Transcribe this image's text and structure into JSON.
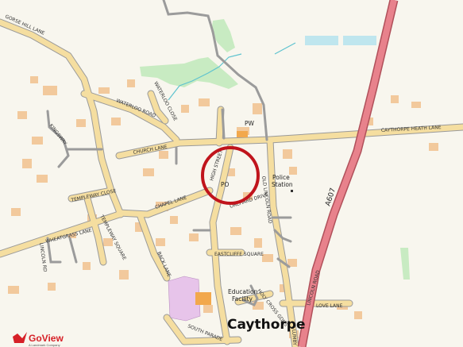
{
  "map": {
    "place_name": "Caythorpe",
    "road_labels": {
      "gorse_hill_lane": "GORSE HILL LANE",
      "waterloo_road": "WATERLOO ROAD",
      "waterloo_close": "WATERLOO CLOSE",
      "kingsway": "KINGSWAY",
      "church_lane": "CHURCH LANE",
      "high_street": "HIGH STREET",
      "templeway_close": "TEMPLEWAY CLOSE",
      "chapel_lane": "CHAPEL LANE",
      "templeway_square": "TEMPLEWAY SQUARE",
      "wheatgrass_lane": "WHEATGRASS LANE",
      "lincoln_road_lower": "LINCOLN RD",
      "orchard_drive": "ORCHARD DRIVE",
      "old_lincoln_road": "OLD LINCOLN ROAD",
      "caythorpe_heath_lane": "CAYTHORPE HEATH LANE",
      "a607": "A607",
      "lincoln_road": "LINCOLN ROAD",
      "eastcliffe_square": "EASTCLIFFE SQUARE",
      "back_lane": "BACK LANE",
      "holy_cross_gardens": "HOLY CROSS GDNS",
      "love_lane": "LOVE LANE",
      "south_parade": "SOUTH PARADE",
      "lumby": "LUMBY"
    },
    "poi_labels": {
      "pw": "PW",
      "police_station_line1": "Police",
      "police_station_line2": "Station",
      "po": "PO",
      "education_line1": "Education",
      "education_line2": "Facility"
    },
    "colors": {
      "background": "#f8f6ee",
      "minor_road": "#f5dea0",
      "major_road": "#e8828c",
      "building": "#f2c99c",
      "greenspace": "#c8ebc2",
      "water": "#bfe6ee",
      "highlight_circle": "#c0141c",
      "education_area": "#e7c4ea"
    }
  },
  "branding": {
    "logo_name": "GoView",
    "logo_tagline": "A Landmark Company"
  }
}
